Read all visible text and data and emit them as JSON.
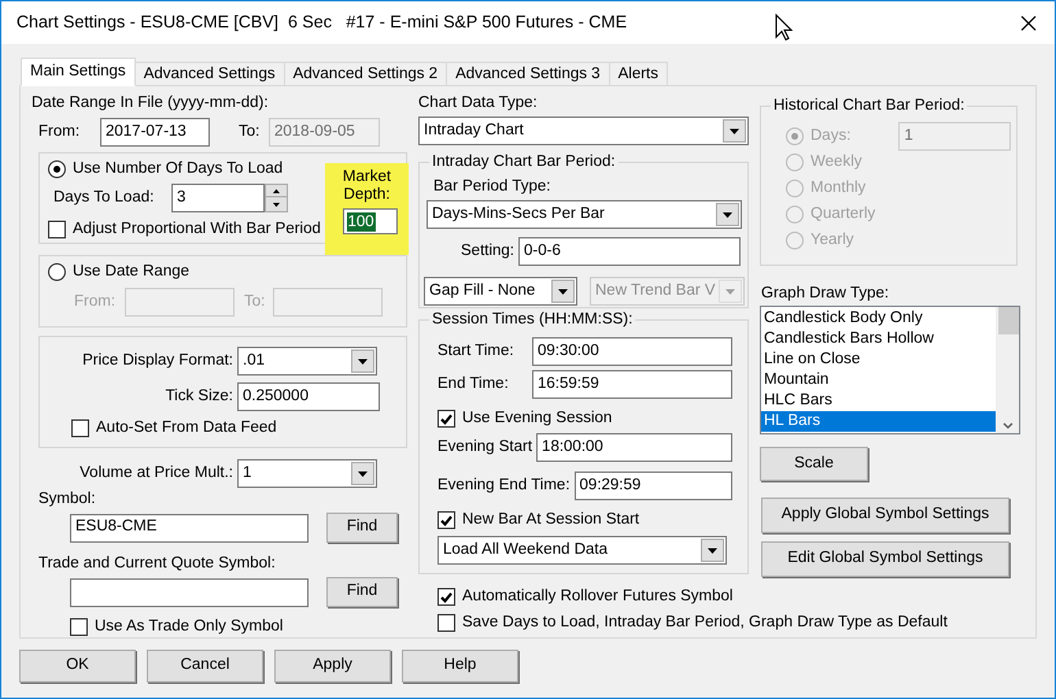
{
  "window": {
    "title": "Chart Settings - ESU8-CME [CBV]  6 Sec   #17 - E-mini S&P 500 Futures - CME"
  },
  "tabs": [
    {
      "label": "Main Settings",
      "selected": true
    },
    {
      "label": "Advanced Settings",
      "selected": false
    },
    {
      "label": "Advanced Settings 2",
      "selected": false
    },
    {
      "label": "Advanced Settings 3",
      "selected": false
    },
    {
      "label": "Alerts",
      "selected": false
    }
  ],
  "date_range": {
    "label": "Date Range In File (yyyy-mm-dd):",
    "from_label": "From:",
    "from": "2017-07-13",
    "to_label": "To:",
    "to": "2018-09-05"
  },
  "days_group": {
    "radio": {
      "label": "Use Number Of Days To Load",
      "selected": true
    },
    "days_label": "Days To Load:",
    "days": "3",
    "adjust": {
      "label": "Adjust Proportional With Bar Period",
      "checked": false
    },
    "market_depth": {
      "label": "Market Depth:",
      "value": "100",
      "highlighted": true
    }
  },
  "range_group": {
    "radio": {
      "label": "Use Date Range",
      "selected": false
    },
    "from_label": "From:",
    "to_label": "To:"
  },
  "price_group": {
    "format_label": "Price Display Format:",
    "format": ".01",
    "tick_label": "Tick Size:",
    "tick": "0.250000",
    "auto_set": {
      "label": "Auto-Set From Data Feed",
      "checked": false
    }
  },
  "volume_mult": {
    "label": "Volume at Price Mult.:",
    "value": "1"
  },
  "symbol": {
    "label": "Symbol:",
    "value": "ESU8-CME",
    "button": "Find"
  },
  "trade_symbol": {
    "label": "Trade and Current Quote Symbol:",
    "button": "Find"
  },
  "trade_only": {
    "label": "Use As Trade Only Symbol",
    "checked": false
  },
  "chart_data_type": {
    "label": "Chart Data Type:",
    "value": "Intraday Chart"
  },
  "intraday": {
    "title": "Intraday Chart Bar Period:",
    "type_label": "Bar Period Type:",
    "type": "Days-Mins-Secs Per Bar",
    "setting_label": "Setting:",
    "setting": "0-0-6",
    "gap_fill": "Gap Fill - None",
    "new_trend": "New Trend Bar V"
  },
  "session": {
    "title": "Session Times (HH:MM:SS):",
    "start_label": "Start Time:",
    "start": "09:30:00",
    "end_label": "End Time:",
    "end": "16:59:59",
    "evening": {
      "label": "Use Evening Session",
      "checked": true
    },
    "evening_start_label": "Evening Start",
    "evening_start": "18:00:00",
    "evening_end_label": "Evening End Time:",
    "evening_end": "09:29:59",
    "new_bar": {
      "label": "New Bar At Session Start",
      "checked": true
    },
    "weekend": "Load All Weekend Data"
  },
  "rollover": {
    "label": "Automatically Rollover Futures Symbol",
    "checked": true
  },
  "save_default": {
    "label": "Save Days to Load, Intraday Bar Period, Graph Draw Type as Default",
    "checked": false
  },
  "historical": {
    "title": "Historical Chart Bar Period:",
    "disabled": true,
    "days_value": "1",
    "options": [
      {
        "label": "Days:",
        "selected": true
      },
      {
        "label": "Weekly",
        "selected": false
      },
      {
        "label": "Monthly",
        "selected": false
      },
      {
        "label": "Quarterly",
        "selected": false
      },
      {
        "label": "Yearly",
        "selected": false
      }
    ]
  },
  "graph_draw": {
    "label": "Graph Draw Type:",
    "items": [
      {
        "label": "Candlestick Body Only",
        "selected": false
      },
      {
        "label": "Candlestick Bars Hollow",
        "selected": false
      },
      {
        "label": "Line on Close",
        "selected": false
      },
      {
        "label": "Mountain",
        "selected": false
      },
      {
        "label": "HLC Bars",
        "selected": false
      },
      {
        "label": "HL Bars",
        "selected": true
      }
    ]
  },
  "side_buttons": {
    "scale": "Scale",
    "apply_global": "Apply Global Symbol Settings",
    "edit_global": "Edit Global Symbol Settings"
  },
  "footer_buttons": [
    "OK",
    "Cancel",
    "Apply",
    "Help"
  ]
}
